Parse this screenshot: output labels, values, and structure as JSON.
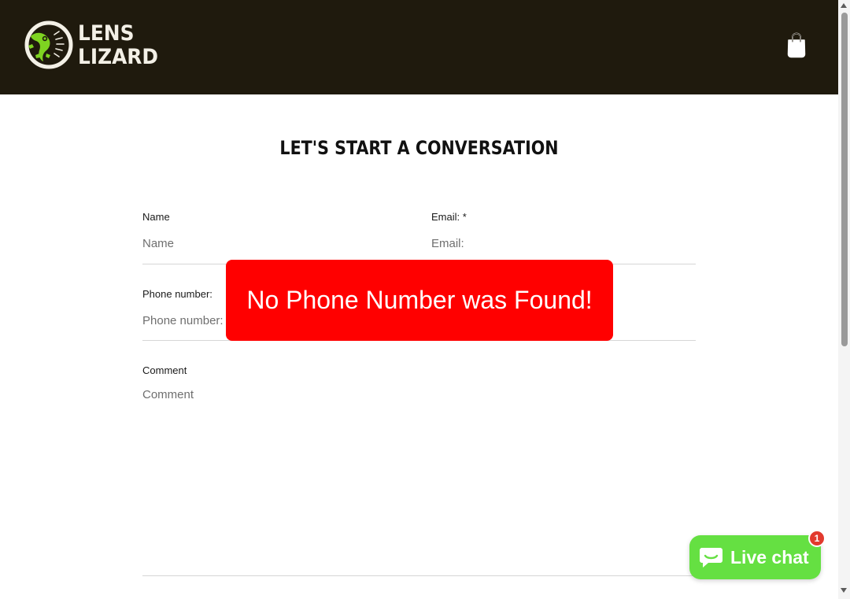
{
  "header": {
    "logo": {
      "line1": "LENS",
      "line2": "LIZARD"
    },
    "cart_icon": "shopping-bag-icon"
  },
  "page_title": "LET'S START A CONVERSATION",
  "form": {
    "name": {
      "label": "Name",
      "placeholder": "Name",
      "value": ""
    },
    "email": {
      "label": "Email: *",
      "placeholder": "Email:",
      "value": ""
    },
    "phone": {
      "label": "Phone number:",
      "placeholder": "Phone number:",
      "value": ""
    },
    "comment": {
      "label": "Comment",
      "placeholder": "Comment",
      "value": ""
    }
  },
  "toast": {
    "message": "No Phone Number was Found!"
  },
  "live_chat": {
    "label": "Live chat",
    "badge_count": "1",
    "icon": "chat-bubble-icon"
  },
  "colors": {
    "header_bg": "#1f1a0d",
    "toast_bg": "#ff0000",
    "chat_bg": "#65e042",
    "badge_bg": "#e23a2e",
    "logo_green": "#7ed321"
  }
}
